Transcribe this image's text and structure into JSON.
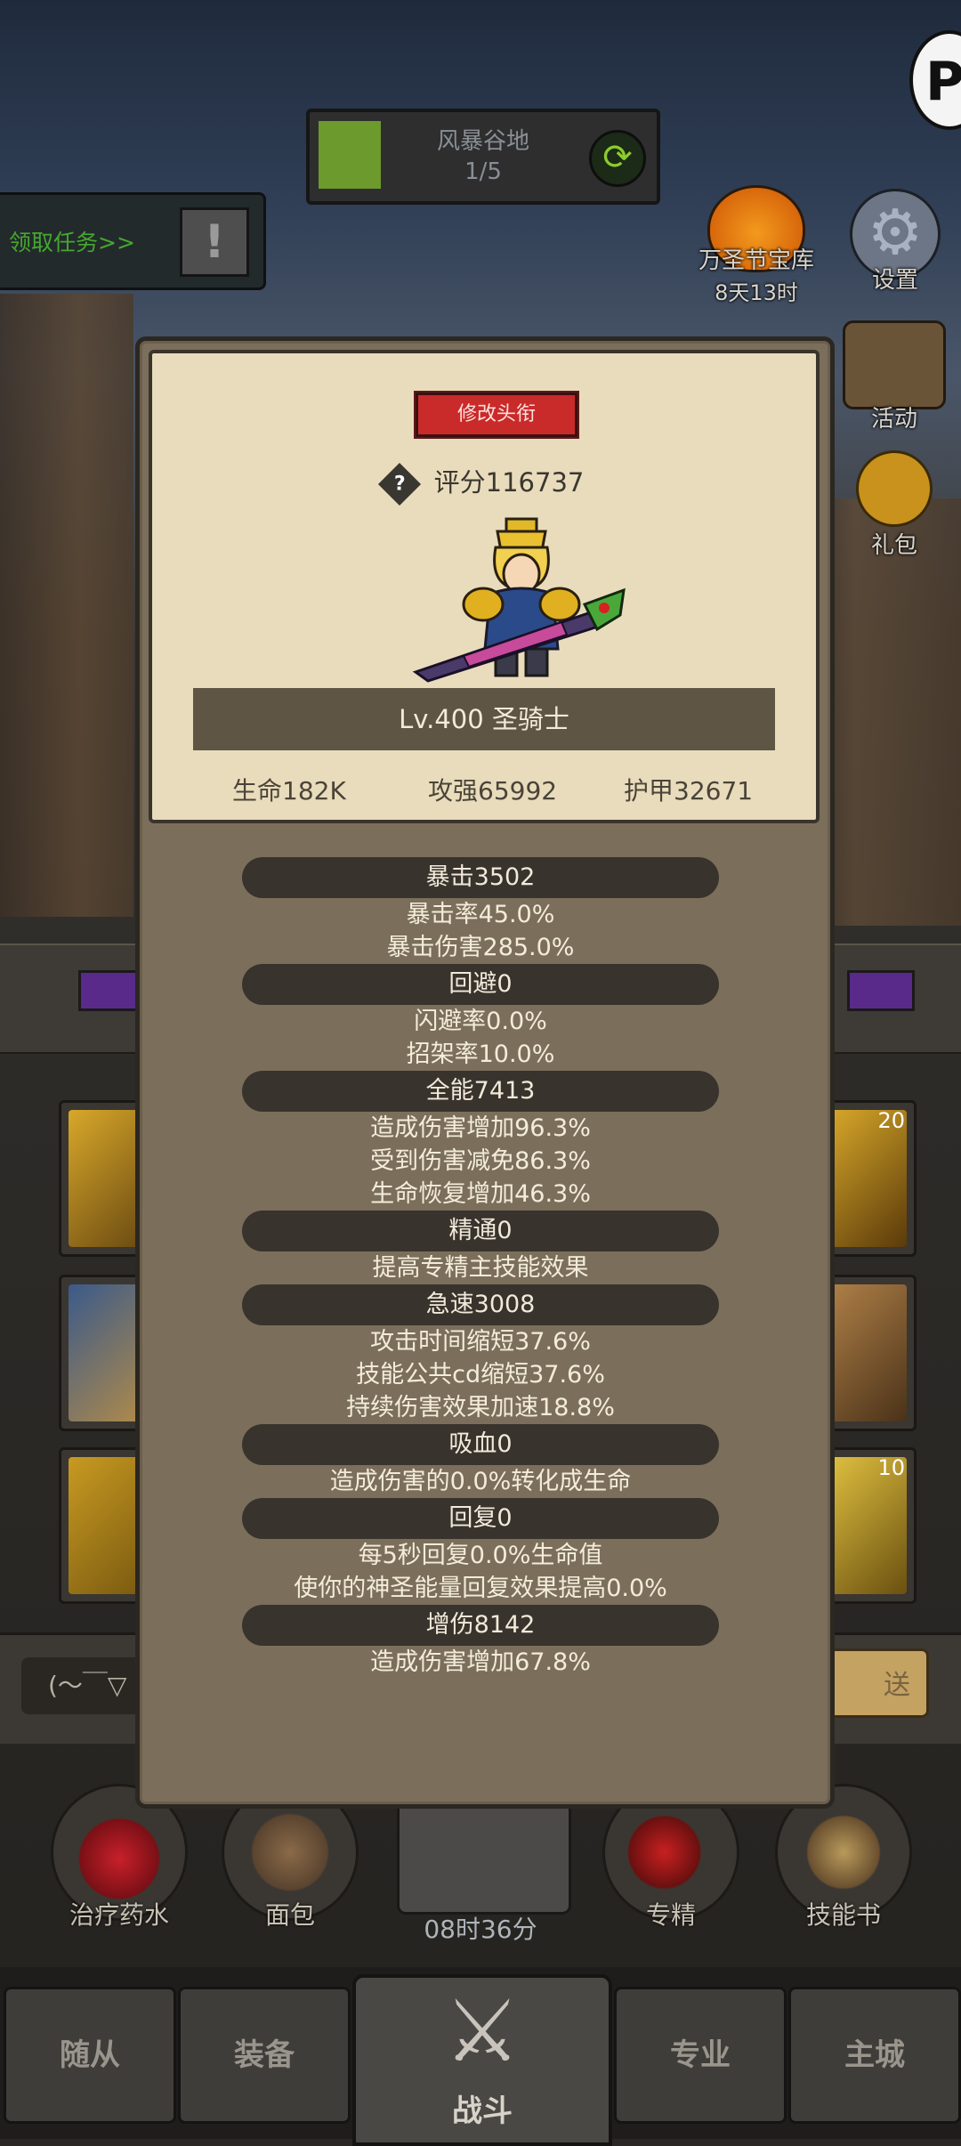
{
  "zone": {
    "name": "风暴谷地",
    "progress": "1/5"
  },
  "quest": {
    "label": "领取任务>>"
  },
  "side_buttons": {
    "halloween_label": "万圣节宝库",
    "halloween_timer": "8天13时",
    "settings": "设置",
    "activity": "活动",
    "gift": "礼包"
  },
  "profile": {
    "rename_button": "修改头衔",
    "score": "评分116737",
    "level_class": "Lv.400 圣骑士",
    "hp": "生命182K",
    "attack": "攻强65992",
    "armor": "护甲32671"
  },
  "attributes": [
    {
      "head": "暴击3502",
      "subs": [
        "暴击率45.0%",
        "暴击伤害285.0%"
      ]
    },
    {
      "head": "回避0",
      "subs": [
        "闪避率0.0%",
        "招架率10.0%"
      ]
    },
    {
      "head": "全能7413",
      "subs": [
        "造成伤害增加96.3%",
        "受到伤害减免86.3%",
        "生命恢复增加46.3%"
      ]
    },
    {
      "head": "精通0",
      "subs": [
        "提高专精主技能效果"
      ]
    },
    {
      "head": "急速3008",
      "subs": [
        "攻击时间缩短37.6%",
        "技能公共cd缩短37.6%",
        "持续伤害效果加速18.8%"
      ]
    },
    {
      "head": "吸血0",
      "subs": [
        "造成伤害的0.0%转化成生命"
      ]
    },
    {
      "head": "回复0",
      "subs": [
        "每5秒回复0.0%生命值",
        "使你的神圣能量回复效果提高0.0%"
      ]
    },
    {
      "head": "增伤8142",
      "subs": [
        "造成伤害增加67.8%"
      ]
    }
  ],
  "slots": {
    "count_top": "20",
    "count_bottom": "10"
  },
  "chat": {
    "input": "(～￣▽",
    "send": "送"
  },
  "items": {
    "potion": "治疗药水",
    "bread": "面包",
    "spec": "专精",
    "skillbook": "技能书",
    "chest_timer": "08时36分"
  },
  "nav": {
    "followers": "随从",
    "equipment": "装备",
    "battle": "战斗",
    "profession": "专业",
    "city": "主城"
  },
  "colors": {
    "panel": "#7b6f5c",
    "parchment": "#e9dcbc",
    "rename_red": "#c92a2a",
    "quest_green": "#45a82e",
    "zone_green": "#6c9a2c"
  }
}
